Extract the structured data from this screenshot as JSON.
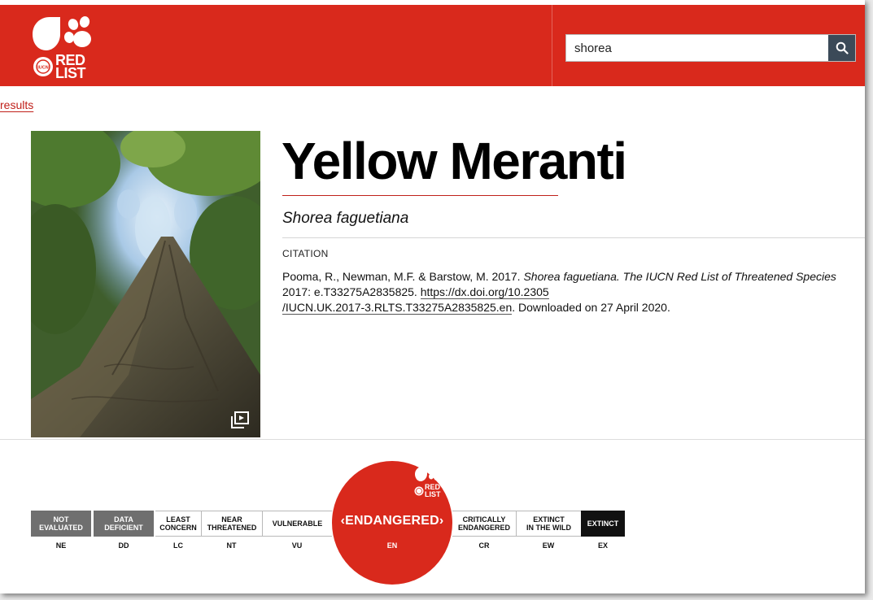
{
  "header": {
    "logo_text_line1": "RED",
    "logo_text_line2": "LIST",
    "logo_badge": "IUCN",
    "search": {
      "value": "shorea"
    },
    "search_icon": "search-icon",
    "background_color": "#d9291c"
  },
  "breadcrumb": {
    "label": "results"
  },
  "species": {
    "common_name": "Yellow Meranti",
    "scientific_name": "Shorea faguetiana",
    "gallery_icon": "gallery-icon"
  },
  "citation": {
    "label": "CITATION",
    "authors": "Pooma, R., Newman, M.F. & Barstow, M. 2017. ",
    "title_italic": "Shorea faguetiana. The IUCN Red List of Threatened Species",
    "year_code": " 2017: e.T33275A2835825. ",
    "doi_url": "https://dx.doi.org/10.2305/IUCN.UK.2017-3.RLTS.T33275A2835825.en",
    "doi_part1": "https://dx.doi.org/10.2305",
    "doi_part2": "/IUCN.UK.2017-3.RLTS.T33275A2835825.en",
    "downloaded": ". Downloaded on 27 April 2020."
  },
  "status_scale": {
    "selected": "EN",
    "categories": [
      {
        "line1": "NOT",
        "line2": "EVALUATED",
        "code": "NE"
      },
      {
        "line1": "DATA",
        "line2": "DEFICIENT",
        "code": "DD"
      },
      {
        "line1": "LEAST",
        "line2": "CONCERN",
        "code": "LC"
      },
      {
        "line1": "NEAR",
        "line2": "THREATENED",
        "code": "NT"
      },
      {
        "line1": "VULNERABLE",
        "line2": "",
        "code": "VU"
      },
      {
        "line1": "ENDANGERED",
        "line2": "",
        "code": "EN"
      },
      {
        "line1": "CRITICALLY",
        "line2": "ENDANGERED",
        "code": "CR"
      },
      {
        "line1": "EXTINCT",
        "line2": "IN THE WILD",
        "code": "EW"
      },
      {
        "line1": "EXTINCT",
        "line2": "",
        "code": "EX"
      }
    ],
    "selected_label": "‹ENDANGERED›",
    "colors": {
      "not_assessed": "#6f6f6f",
      "extinct": "#111111",
      "endangered": "#d9291c"
    }
  }
}
